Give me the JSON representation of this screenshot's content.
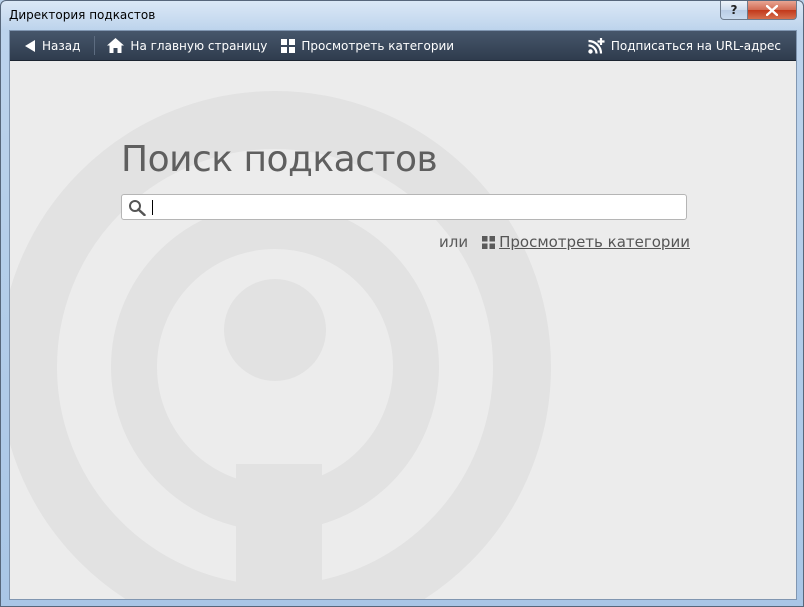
{
  "window": {
    "title": "Директория подкастов",
    "help_label": "?"
  },
  "toolbar": {
    "back": {
      "label": "Назад",
      "icon": "arrow-left-icon"
    },
    "home": {
      "label": "На главную страницу",
      "icon": "home-icon"
    },
    "categories": {
      "label": "Просмотреть категории",
      "icon": "grid-icon"
    },
    "subscribe_url": {
      "label": "Подписаться на URL-адрес",
      "icon": "rss-plus-icon"
    }
  },
  "main": {
    "title": "Поиск подкастов",
    "search": {
      "value": "",
      "placeholder": "",
      "icon": "search-icon"
    },
    "or_label": "или",
    "categories_link": "Просмотреть категории",
    "categories_icon": "grid-icon"
  },
  "colors": {
    "toolbar_bg": "#3a485b",
    "content_bg": "#ececec",
    "title_text": "#5f5f5f",
    "logo_watermark": "#e2e2e2"
  }
}
